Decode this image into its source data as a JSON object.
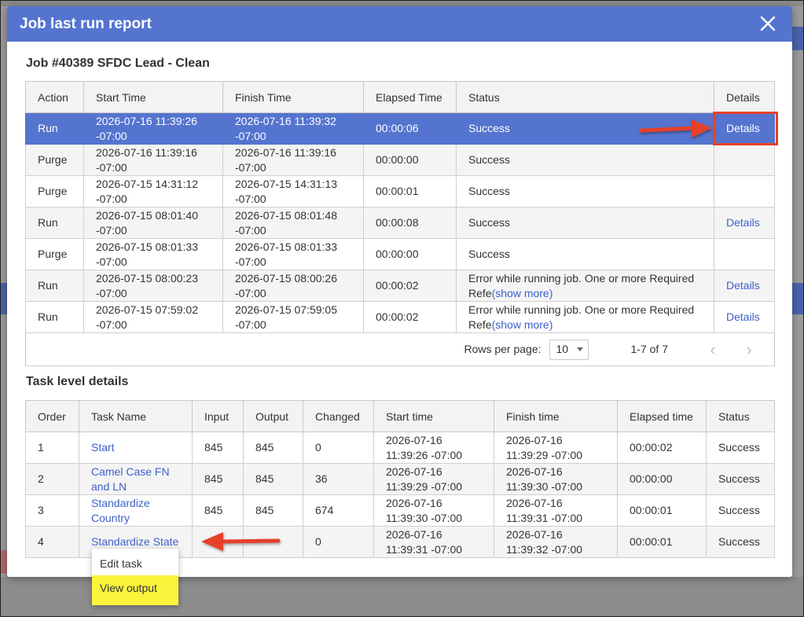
{
  "modal": {
    "title": "Job last run report",
    "job_title": "Job #40389 SFDC Lead - Clean",
    "task_section_title": "Task level details"
  },
  "runs": {
    "headers": [
      "Action",
      "Start Time",
      "Finish Time",
      "Elapsed Time",
      "Status",
      "Details"
    ],
    "rows": [
      {
        "action": "Run",
        "start": "2026-07-16 11:39:26 -07:00",
        "finish": "2026-07-16 11:39:32 -07:00",
        "elapsed": "00:00:06",
        "status": "Success",
        "status_more": "",
        "details": "Details"
      },
      {
        "action": "Purge",
        "start": "2026-07-16 11:39:16 -07:00",
        "finish": "2026-07-16 11:39:16 -07:00",
        "elapsed": "00:00:00",
        "status": "Success",
        "status_more": "",
        "details": ""
      },
      {
        "action": "Purge",
        "start": "2026-07-15 14:31:12 -07:00",
        "finish": "2026-07-15 14:31:13 -07:00",
        "elapsed": "00:00:01",
        "status": "Success",
        "status_more": "",
        "details": ""
      },
      {
        "action": "Run",
        "start": "2026-07-15 08:01:40 -07:00",
        "finish": "2026-07-15 08:01:48 -07:00",
        "elapsed": "00:00:08",
        "status": "Success",
        "status_more": "",
        "details": "Details"
      },
      {
        "action": "Purge",
        "start": "2026-07-15 08:01:33 -07:00",
        "finish": "2026-07-15 08:01:33 -07:00",
        "elapsed": "00:00:00",
        "status": "Success",
        "status_more": "",
        "details": ""
      },
      {
        "action": "Run",
        "start": "2026-07-15 08:00:23 -07:00",
        "finish": "2026-07-15 08:00:26 -07:00",
        "elapsed": "00:00:02",
        "status": "Error while running job. One or more Required Refe",
        "status_more": "(show more)",
        "details": "Details"
      },
      {
        "action": "Run",
        "start": "2026-07-15 07:59:02 -07:00",
        "finish": "2026-07-15 07:59:05 -07:00",
        "elapsed": "00:00:02",
        "status": "Error while running job. One or more Required Refe",
        "status_more": "(show more)",
        "details": "Details"
      }
    ],
    "pager": {
      "rows_label": "Rows per page:",
      "rows_value": "10",
      "range": "1-7 of 7"
    }
  },
  "tasks": {
    "headers": [
      "Order",
      "Task Name",
      "Input",
      "Output",
      "Changed",
      "Start time",
      "Finish time",
      "Elapsed time",
      "Status"
    ],
    "rows": [
      {
        "order": "1",
        "name": "Start",
        "input": "845",
        "output": "845",
        "changed": "0",
        "start": "2026-07-16 11:39:26 -07:00",
        "finish": "2026-07-16 11:39:29 -07:00",
        "elapsed": "00:00:02",
        "status": "Success"
      },
      {
        "order": "2",
        "name": "Camel Case FN and LN",
        "input": "845",
        "output": "845",
        "changed": "36",
        "start": "2026-07-16 11:39:29 -07:00",
        "finish": "2026-07-16 11:39:30 -07:00",
        "elapsed": "00:00:00",
        "status": "Success"
      },
      {
        "order": "3",
        "name": "Standardize Country",
        "input": "845",
        "output": "845",
        "changed": "674",
        "start": "2026-07-16 11:39:30 -07:00",
        "finish": "2026-07-16 11:39:31 -07:00",
        "elapsed": "00:00:01",
        "status": "Success"
      },
      {
        "order": "4",
        "name": "Standardize State",
        "input": "",
        "output": "",
        "changed": "0",
        "start": "2026-07-16 11:39:31 -07:00",
        "finish": "2026-07-16 11:39:32 -07:00",
        "elapsed": "00:00:01",
        "status": "Success"
      }
    ]
  },
  "context_menu": {
    "items": [
      "Edit task",
      "View output"
    ]
  },
  "icons": {
    "close": "close-icon",
    "prev": "chevron-left-icon",
    "next": "chevron-right-icon"
  },
  "colors": {
    "header": "#5574cf",
    "link": "#3e61c8",
    "annotation": "#e5412a",
    "highlight": "#fbf33c"
  }
}
